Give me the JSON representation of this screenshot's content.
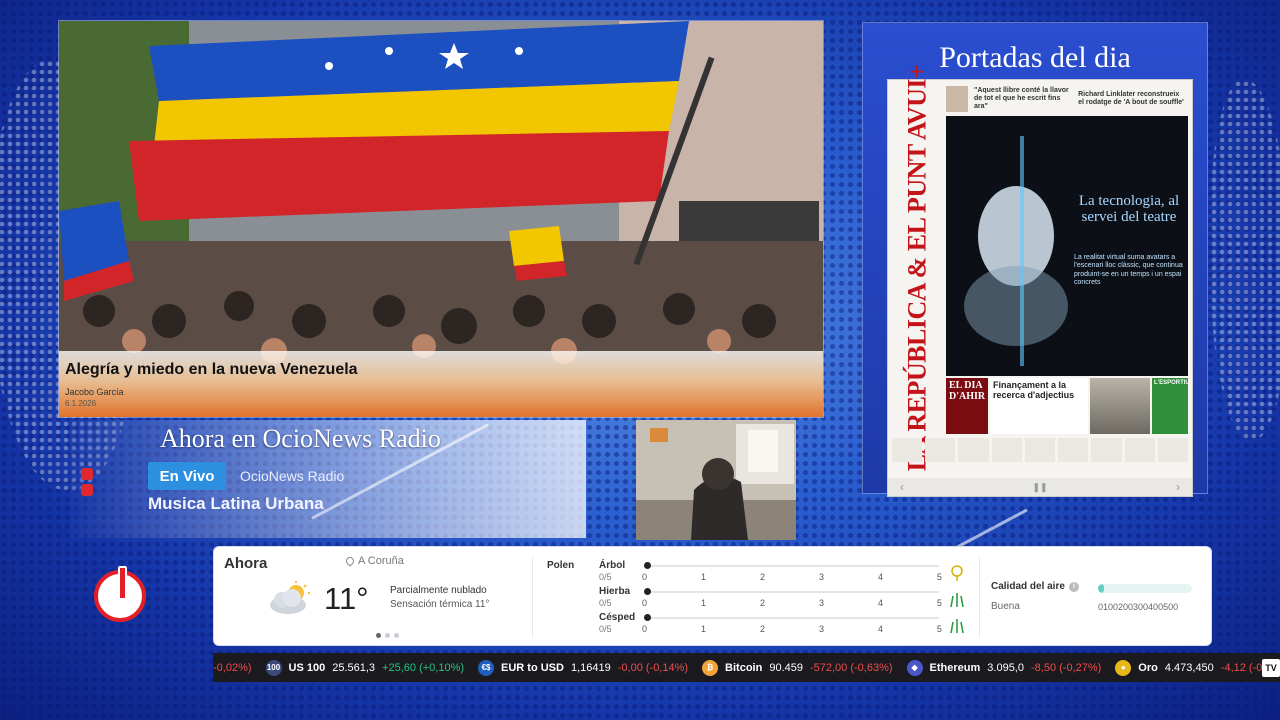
{
  "hero": {
    "title": "Alegría y miedo en la nueva Venezuela",
    "author": "Jacobo García",
    "date": "6.1.2026"
  },
  "radio": {
    "heading": "Ahora en OcioNews Radio",
    "live_label": "En Vivo",
    "station": "OcioNews Radio",
    "program": "Musica Latina Urbana"
  },
  "portadas": {
    "title": "Portadas del dia",
    "paper": {
      "masthead": "LA REPÚBLICA & EL PUNT AVUI+",
      "top_headline_1": "\"Aquest llibre conté la llavor de tot el que he escrit fins ara\"",
      "top_headline_2": "Richard Linklater reconstrueix el rodatge de 'A bout de souffle'",
      "cover_title": "La tecnologia, al servei del teatre",
      "cover_body": "La realitat virtual suma avatars a l'escenari lloc clàssic, que continua produint-se en un temps i un espai concrets",
      "box_red": "EL DIA D'AHIR",
      "box_main": "Finançament a la recerca d'adjectius",
      "box_green": "L'ESPORTIU"
    }
  },
  "weather": {
    "now_label": "Ahora",
    "location": "A Coruña",
    "temperature": "11°",
    "description": "Parcialmente nublado",
    "feels_like": "Sensación térmica 11°",
    "polen_label": "Polen",
    "polen": [
      {
        "name": "Árbol",
        "score": "0/5",
        "level": 0,
        "color": "#d9b300"
      },
      {
        "name": "Hierba",
        "score": "0/5",
        "level": 0,
        "color": "#2e9e44"
      },
      {
        "name": "Césped",
        "score": "0/5",
        "level": 0,
        "color": "#2e9e44"
      }
    ],
    "polen_ticks": [
      "0",
      "1",
      "2",
      "3",
      "4",
      "5"
    ],
    "air_label": "Calidad del aire",
    "air_value": "Buena",
    "air_scale": "0100200300400500",
    "air_level_fraction": 0.06
  },
  "ticker": [
    {
      "icon": "",
      "name": "",
      "price": "",
      "change": "-0,02%)",
      "dir": "down",
      "icon_color": ""
    },
    {
      "icon": "100",
      "name": "US 100",
      "price": "25.561,3",
      "change": "+25,60 (+0,10%)",
      "dir": "up",
      "icon_color": "#3a4a7a"
    },
    {
      "icon": "€$",
      "name": "EUR to USD",
      "price": "1,16419",
      "change": "-0,00 (-0,14%)",
      "dir": "down",
      "icon_color": "#1f5fbf"
    },
    {
      "icon": "₿",
      "name": "Bitcoin",
      "price": "90.459",
      "change": "-572,00 (-0,63%)",
      "dir": "down",
      "icon_color": "#f2a33a"
    },
    {
      "icon": "◆",
      "name": "Ethereum",
      "price": "3.095,0",
      "change": "-8,50 (-0,27%)",
      "dir": "down",
      "icon_color": "#4a57c8"
    },
    {
      "icon": "●",
      "name": "Oro",
      "price": "4.473,450",
      "change": "-4,12 (-0",
      "dir": "down",
      "icon_color": "#e6b81a"
    }
  ],
  "ticker_logo": "TV",
  "colors": {
    "accent_red": "#e3202a",
    "live_blue": "#2d8fe0",
    "up": "#26c281",
    "down": "#ef4b4b"
  }
}
